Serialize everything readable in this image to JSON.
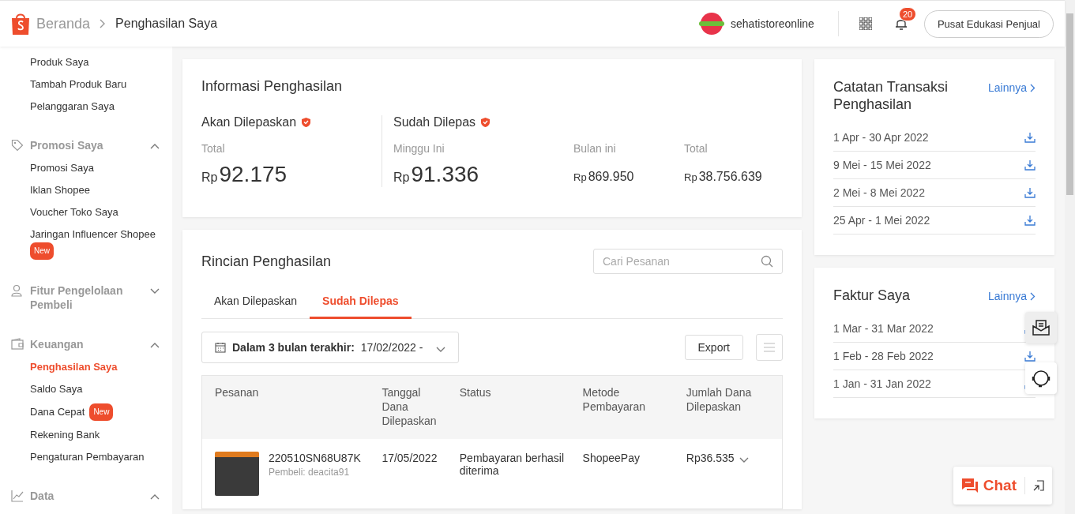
{
  "header": {
    "breadcrumb": [
      {
        "label": "Beranda",
        "current": false
      },
      {
        "label": "Penghasilan Saya",
        "current": true
      }
    ],
    "store_name": "sehatistoreonline",
    "notification_count": "20",
    "edu_button": "Pusat Edukasi Penjual"
  },
  "sidebar": {
    "top_items": [
      {
        "label": "Produk Saya",
        "selected": false
      },
      {
        "label": "Tambah Produk Baru",
        "selected": false
      },
      {
        "label": "Pelanggaran Saya",
        "selected": false
      }
    ],
    "groups": [
      {
        "kind": "tag",
        "title": "Promosi Saya",
        "expanded": true,
        "items": [
          {
            "label": "Promosi Saya",
            "selected": false
          },
          {
            "label": "Iklan Shopee",
            "selected": false
          },
          {
            "label": "Voucher Toko Saya",
            "selected": false
          },
          {
            "label": "Jaringan Influencer Shopee",
            "selected": false,
            "badge": "New"
          }
        ]
      },
      {
        "kind": "person",
        "title": "Fitur Pengelolaan Pembeli",
        "expanded": false
      },
      {
        "kind": "wallet",
        "title": "Keuangan",
        "expanded": true,
        "items": [
          {
            "label": "Penghasilan Saya",
            "selected": true
          },
          {
            "label": "Saldo Saya",
            "selected": false
          },
          {
            "label": "Dana Cepat",
            "selected": false,
            "badge": "New"
          },
          {
            "label": "Rekening Bank",
            "selected": false
          },
          {
            "label": "Pengaturan Pembayaran",
            "selected": false
          }
        ]
      },
      {
        "kind": "chart",
        "title": "Data",
        "expanded": true
      }
    ]
  },
  "income_info": {
    "title": "Informasi Penghasilan",
    "sections": [
      {
        "title": "Akan Dilepaskan",
        "metrics": [
          {
            "kind": "primary",
            "label": "Total",
            "currency": "Rp",
            "amount": "92.175"
          }
        ]
      },
      {
        "title": "Sudah Dilepas",
        "metrics": [
          {
            "kind": "primary",
            "label": "Minggu Ini",
            "currency": "Rp",
            "amount": "91.336"
          },
          {
            "kind": "secondary",
            "label": "Bulan ini",
            "currency": "Rp",
            "amount": "869.950"
          },
          {
            "kind": "secondary",
            "label": "Total",
            "currency": "Rp",
            "amount": "38.756.639"
          }
        ]
      }
    ]
  },
  "income_details": {
    "title": "Rincian Penghasilan",
    "search": {
      "placeholder": "Cari Pesanan"
    },
    "tabs": [
      {
        "label": "Akan Dilepaskan",
        "selected": false
      },
      {
        "label": "Sudah Dilepas",
        "selected": true
      }
    ],
    "date_filter": {
      "label": "Dalam 3 bulan terakhir:",
      "value": "17/02/2022 -"
    },
    "export_button": "Export",
    "table": {
      "columns": [
        "Pesanan",
        "Tanggal Dana Dilepaskan",
        "Status",
        "Metode Pembayaran",
        "Jumlah Dana Dilepaskan"
      ],
      "rows": [
        {
          "order_id": "220510SN68U87K",
          "buyer": "Pembeli: deacita91",
          "date": "17/05/2022",
          "status": "Pembayaran berhasil diterima",
          "payment": "ShopeePay",
          "amount": "Rp36.535"
        }
      ]
    }
  },
  "transaction_records": {
    "title": "Catatan Transaksi Penghasilan",
    "link": "Lainnya",
    "items": [
      "1 Apr - 30 Apr 2022",
      "9 Mei - 15 Mei 2022",
      "2 Mei - 8 Mei 2022",
      "25 Apr - 1 Mei 2022"
    ]
  },
  "invoices": {
    "title": "Faktur Saya",
    "link": "Lainnya",
    "items": [
      "1 Mar - 31 Mar 2022",
      "1 Feb - 28 Feb 2022",
      "1 Jan - 31 Jan 2022"
    ]
  },
  "chat": {
    "label": "Chat"
  }
}
